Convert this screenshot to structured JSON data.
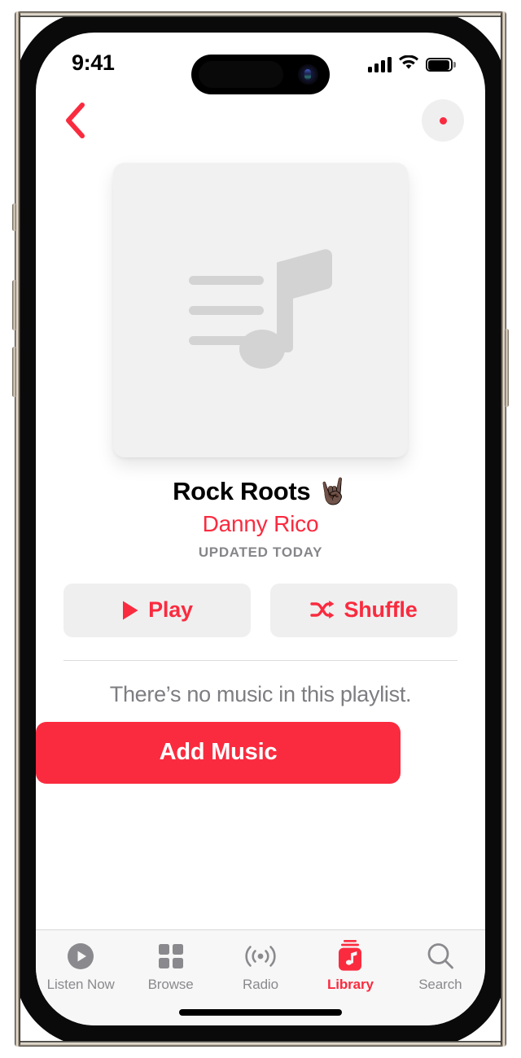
{
  "device": {
    "name": "iphone-frame",
    "side_buttons": [
      "silent-switch",
      "volume-up",
      "volume-down",
      "power"
    ]
  },
  "status_bar": {
    "time": "9:41",
    "cellular_icon": "cellular-bars-icon",
    "wifi_icon": "wifi-icon",
    "battery_icon": "battery-icon"
  },
  "nav_bar": {
    "back_icon": "chevron-left-icon",
    "more_icon": "more-ellipsis-icon",
    "accent_color": "#FA2B3F"
  },
  "artwork": {
    "placeholder_icon": "music-note-playlist-icon",
    "background_color": "#F1F1F1",
    "glyph_color": "#D2D2D2"
  },
  "playlist": {
    "title": "Rock Roots 🤘🏿",
    "artist": "Danny Rico",
    "meta": "UPDATED TODAY"
  },
  "actions": {
    "play": {
      "label": "Play",
      "icon": "play-triangle-icon"
    },
    "shuffle": {
      "label": "Shuffle",
      "icon": "shuffle-arrows-icon"
    }
  },
  "empty_state": {
    "message": "There’s no music in this playlist.",
    "add_music_label": "Add Music",
    "add_music_color": "#FA2B3F"
  },
  "tab_bar": {
    "items": [
      {
        "label": "Listen Now",
        "icon": "play-circle-icon",
        "active": false
      },
      {
        "label": "Browse",
        "icon": "grid-squares-icon",
        "active": false
      },
      {
        "label": "Radio",
        "icon": "broadcast-waves-icon",
        "active": false
      },
      {
        "label": "Library",
        "icon": "library-music-icon",
        "active": true
      },
      {
        "label": "Search",
        "icon": "magnifier-icon",
        "active": false
      }
    ]
  }
}
